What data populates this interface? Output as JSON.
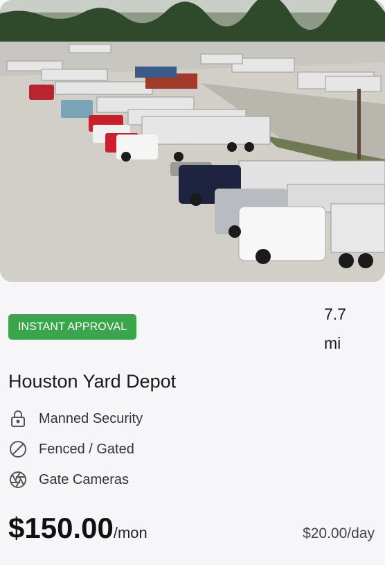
{
  "listing": {
    "badge": "INSTANT APPROVAL",
    "distance": "7.7 mi",
    "title": "Houston Yard Depot",
    "features": [
      {
        "label": "Manned Security",
        "icon": "lock-icon"
      },
      {
        "label": "Fenced / Gated",
        "icon": "blocked-circle-icon"
      },
      {
        "label": "Gate Cameras",
        "icon": "camera-shutter-icon"
      }
    ],
    "price": "$150.00",
    "price_unit": "/mon",
    "daily_price": "$20.00/day",
    "photo": "aerial-truck-yard-photo"
  },
  "colors": {
    "badge_bg": "#3aa54a",
    "text": "#1a1a1a"
  }
}
